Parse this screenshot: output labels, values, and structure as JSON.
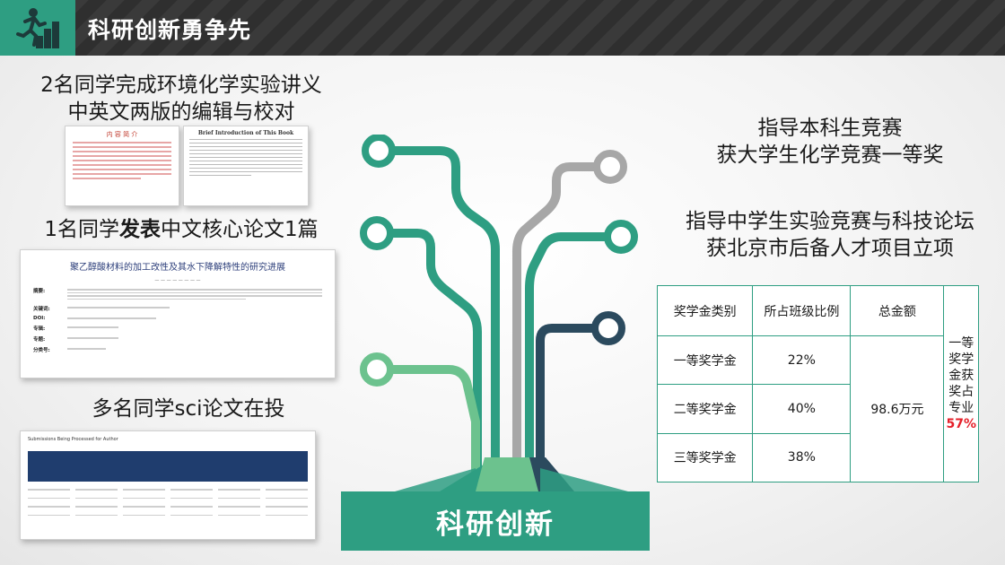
{
  "header": {
    "title": "科研创新勇争先",
    "icon": "running-person-stairs-icon"
  },
  "left": {
    "item1_line1": "2名同学完成环境化学实验讲义",
    "item1_line2": "中英文两版的编辑与校对",
    "item2_prefix": "1名同学",
    "item2_bold": "发表",
    "item2_suffix": "中文核心论文1篇",
    "item3": "多名同学sci论文在投",
    "doc1_title": "内 容 简 介",
    "doc2_title": "Brief Introduction of This Book",
    "paper_title": "聚乙醇酸材料的加工改性及其水下降解特性的研究进展",
    "paper_fields": [
      "摘要:",
      "关键词:",
      "DOI:",
      "专辑:",
      "专题:",
      "分类号:"
    ],
    "sub_title": "Submissions Being Processed for Author"
  },
  "right": {
    "award1_line1": "指导本科生竞赛",
    "award1_line2": "获大学生化学竞赛一等奖",
    "award2_line1": "指导中学生实验竞赛与科技论坛",
    "award2_line2": "获北京市后备人才项目立项"
  },
  "table": {
    "headers": [
      "奖学金类别",
      "所占班级比例",
      "总金额"
    ],
    "rows": [
      {
        "type": "一等奖学金",
        "ratio": "22%"
      },
      {
        "type": "二等奖学金",
        "ratio": "40%"
      },
      {
        "type": "三等奖学金",
        "ratio": "38%"
      }
    ],
    "total": "98.6万元",
    "note_text": "一等奖学金获奖占专业",
    "note_pct": "57%"
  },
  "center": {
    "label": "科研创新"
  },
  "colors": {
    "accent": "#2e9e82",
    "dark_teal": "#2b4a5e",
    "light_green": "#6cc28e",
    "gray": "#a7a7a7",
    "red": "#e5202a"
  }
}
